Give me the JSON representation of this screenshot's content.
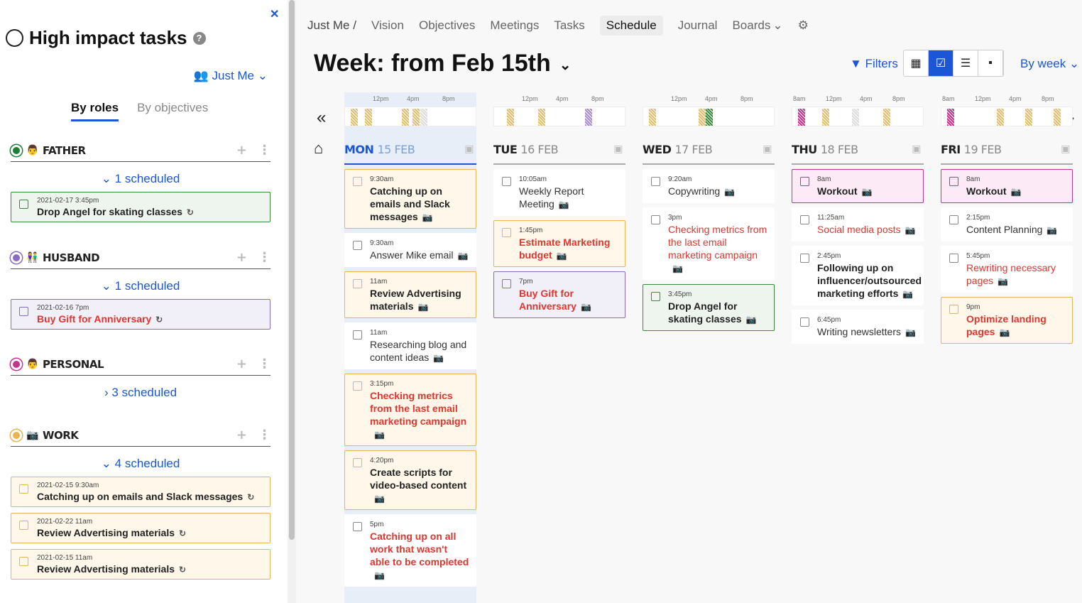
{
  "left": {
    "title": "High impact tasks",
    "owner": "Just Me",
    "tabs": [
      "By roles",
      "By objectives"
    ],
    "roles": [
      {
        "name": "FATHER",
        "color": "#1e7e34",
        "scheduled": "1 scheduled",
        "expanded": true,
        "cards": [
          {
            "date": "2021-02-17 3:45pm",
            "name": "Drop Angel for skating classes",
            "style": "fam"
          }
        ]
      },
      {
        "name": "HUSBAND",
        "color": "#8a6bbf",
        "scheduled": "1 scheduled",
        "expanded": true,
        "cards": [
          {
            "date": "2021-02-16 7pm",
            "name": "Buy Gift for Anniversary",
            "style": "hus"
          }
        ]
      },
      {
        "name": "PERSONAL",
        "color": "#c2358e",
        "scheduled": "3 scheduled",
        "expanded": false,
        "cards": []
      },
      {
        "name": "WORK",
        "color": "#e9b553",
        "scheduled": "4 scheduled",
        "expanded": true,
        "cards": [
          {
            "date": "2021-02-15 9:30am",
            "name": "Catching up on emails and Slack messages",
            "style": "work"
          },
          {
            "date": "2021-02-22 11am",
            "name": "Review Advertising materials",
            "style": "work"
          },
          {
            "date": "2021-02-15 11am",
            "name": "Review Advertising materials",
            "style": "work"
          }
        ]
      }
    ]
  },
  "nav": {
    "items": [
      "Just Me /",
      "Vision",
      "Objectives",
      "Meetings",
      "Tasks",
      "Schedule",
      "Journal",
      "Boards"
    ],
    "active": "Schedule"
  },
  "week_title": "Week: from Feb 15th",
  "filters": "Filters",
  "by_week": "By week",
  "ticks": [
    "12pm",
    "4pm",
    "8pm",
    "8am"
  ],
  "days": [
    {
      "dow": "MON",
      "date": "15 FEB",
      "today": true,
      "tasks": [
        {
          "time": "9:30am",
          "name": "Catching up on emails and Slack messages",
          "style": "work",
          "weight": "b"
        },
        {
          "time": "9:30am",
          "name": "Answer Mike email",
          "style": "plain",
          "weight": ""
        },
        {
          "time": "11am",
          "name": "Review Advertising materials",
          "style": "work",
          "weight": "b"
        },
        {
          "time": "11am",
          "name": "Researching blog and content ideas",
          "style": "plain",
          "weight": ""
        },
        {
          "time": "3:15pm",
          "name": "Checking metrics from the last email marketing campaign",
          "style": "work",
          "weight": "rb"
        },
        {
          "time": "4:20pm",
          "name": "Create scripts for video-based content",
          "style": "work",
          "weight": "b"
        },
        {
          "time": "5pm",
          "name": "Catching up on all work that wasn't able to be completed",
          "style": "plain",
          "weight": "rb"
        }
      ]
    },
    {
      "dow": "TUE",
      "date": "16 FEB",
      "today": false,
      "tasks": [
        {
          "time": "10:05am",
          "name": "Weekly Report Meeting",
          "style": "plain",
          "weight": ""
        },
        {
          "time": "1:45pm",
          "name": "Estimate Marketing budget",
          "style": "work",
          "weight": "rb"
        },
        {
          "time": "7pm",
          "name": "Buy Gift for Anniversary",
          "style": "hus",
          "weight": "rb"
        }
      ]
    },
    {
      "dow": "WED",
      "date": "17 FEB",
      "today": false,
      "tasks": [
        {
          "time": "9:20am",
          "name": "Copywriting",
          "style": "plain",
          "weight": ""
        },
        {
          "time": "3pm",
          "name": "Checking metrics from the last email marketing campaign",
          "style": "plain",
          "weight": "r"
        },
        {
          "time": "3:45pm",
          "name": "Drop Angel for skating classes",
          "style": "fam",
          "weight": "b"
        }
      ]
    },
    {
      "dow": "THU",
      "date": "18 FEB",
      "today": false,
      "tasks": [
        {
          "time": "8am",
          "name": "Workout",
          "style": "pers",
          "weight": "b"
        },
        {
          "time": "11:25am",
          "name": "Social media posts",
          "style": "plain",
          "weight": "r"
        },
        {
          "time": "2:45pm",
          "name": "Following up on influencer/outsourced marketing efforts",
          "style": "plain",
          "weight": "b"
        },
        {
          "time": "6:45pm",
          "name": "Writing newsletters",
          "style": "plain",
          "weight": ""
        }
      ]
    },
    {
      "dow": "FRI",
      "date": "19 FEB",
      "today": false,
      "tasks": [
        {
          "time": "8am",
          "name": "Workout",
          "style": "pers",
          "weight": "b"
        },
        {
          "time": "2:15pm",
          "name": "Content Planning",
          "style": "plain",
          "weight": ""
        },
        {
          "time": "5:45pm",
          "name": "Rewriting necessary pages",
          "style": "plain",
          "weight": "r"
        },
        {
          "time": "9pm",
          "name": "Optimize landing pages",
          "style": "work",
          "weight": "rb"
        }
      ]
    }
  ]
}
